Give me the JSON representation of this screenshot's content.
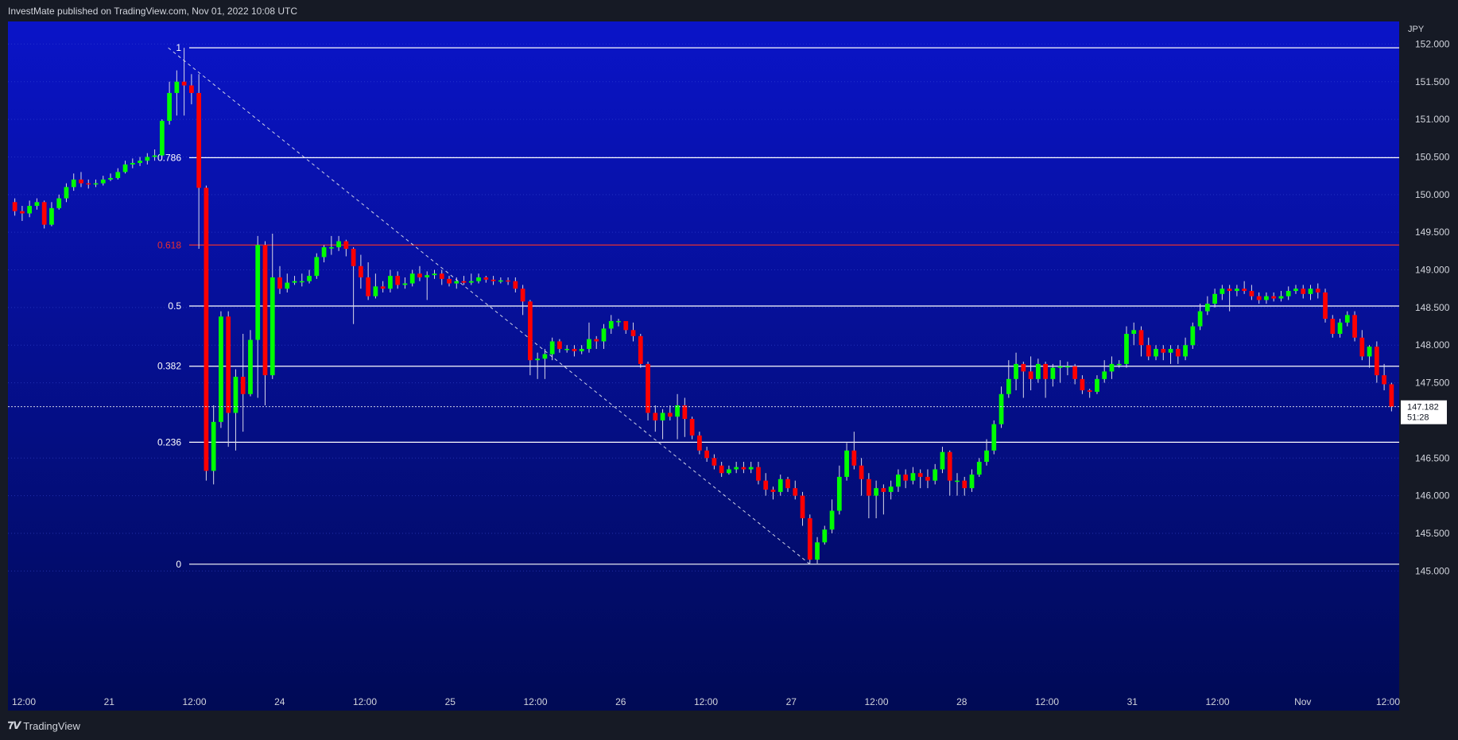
{
  "header": {
    "attribution": "InvestMate published on TradingView.com, Nov 01, 2022 10:08 UTC"
  },
  "footer": {
    "brand": "TradingView"
  },
  "colors": {
    "bg_top": "#0a14c8",
    "bg_bottom": "#000a55",
    "up": "#00ff00",
    "down": "#ff0000",
    "wick": "#d8d8e8",
    "level": "#ffffff",
    "level_618": "#e83030"
  },
  "chart_data": {
    "type": "candlestick",
    "symbol_currency": "JPY",
    "last_price_label": "147.182",
    "countdown_label": "51:28",
    "ylim": [
      144.75,
      152.3
    ],
    "y_ticks": [
      "152.000",
      "151.500",
      "151.000",
      "150.500",
      "150.000",
      "149.500",
      "149.000",
      "148.500",
      "148.000",
      "147.500",
      "146.500",
      "146.000",
      "145.500",
      "145.000"
    ],
    "x_ticks": [
      "12:00",
      "21",
      "12:00",
      "24",
      "12:00",
      "25",
      "12:00",
      "26",
      "12:00",
      "27",
      "12:00",
      "28",
      "12:00",
      "31",
      "12:00",
      "Nov",
      "12:00"
    ],
    "fib_levels": [
      {
        "label": "1",
        "price": 151.95
      },
      {
        "label": "0.786",
        "price": 150.49
      },
      {
        "label": "0.618",
        "price": 149.33
      },
      {
        "label": "0.5",
        "price": 148.52
      },
      {
        "label": "0.382",
        "price": 147.72
      },
      {
        "label": "0.236",
        "price": 146.71
      },
      {
        "label": "0",
        "price": 145.09
      }
    ],
    "candles": [
      [
        149.9,
        149.78,
        149.95,
        149.72
      ],
      [
        149.78,
        149.75,
        149.85,
        149.65
      ],
      [
        149.75,
        149.85,
        149.92,
        149.7
      ],
      [
        149.85,
        149.9,
        149.95,
        149.8
      ],
      [
        149.9,
        149.6,
        149.92,
        149.55
      ],
      [
        149.6,
        149.82,
        149.9,
        149.58
      ],
      [
        149.82,
        149.95,
        150.0,
        149.8
      ],
      [
        149.95,
        150.1,
        150.15,
        149.9
      ],
      [
        150.1,
        150.2,
        150.28,
        150.05
      ],
      [
        150.2,
        150.15,
        150.3,
        150.1
      ],
      [
        150.15,
        150.14,
        150.2,
        150.08
      ],
      [
        150.14,
        150.15,
        150.2,
        150.1
      ],
      [
        150.15,
        150.2,
        150.25,
        150.12
      ],
      [
        150.2,
        150.22,
        150.28,
        150.18
      ],
      [
        150.22,
        150.3,
        150.35,
        150.2
      ],
      [
        150.3,
        150.4,
        150.45,
        150.28
      ],
      [
        150.4,
        150.42,
        150.48,
        150.35
      ],
      [
        150.42,
        150.45,
        150.5,
        150.38
      ],
      [
        150.45,
        150.5,
        150.55,
        150.4
      ],
      [
        150.5,
        150.52,
        150.6,
        150.45
      ],
      [
        150.52,
        150.98,
        151.0,
        150.5
      ],
      [
        150.98,
        151.35,
        151.5,
        150.93
      ],
      [
        151.35,
        151.5,
        151.65,
        151.05
      ],
      [
        151.5,
        151.45,
        151.95,
        151.05
      ],
      [
        151.45,
        151.35,
        151.6,
        151.2
      ],
      [
        151.35,
        150.09,
        151.6,
        149.28
      ],
      [
        150.09,
        146.33,
        150.12,
        146.2
      ],
      [
        146.33,
        146.98,
        147.2,
        146.15
      ],
      [
        146.98,
        148.38,
        148.45,
        146.9
      ],
      [
        148.38,
        147.1,
        148.45,
        146.65
      ],
      [
        147.1,
        147.58,
        147.68,
        146.6
      ],
      [
        147.58,
        147.35,
        148.15,
        146.85
      ],
      [
        147.35,
        148.07,
        148.2,
        147.32
      ],
      [
        148.07,
        149.33,
        149.45,
        147.3
      ],
      [
        149.33,
        147.6,
        149.38,
        147.2
      ],
      [
        147.6,
        148.9,
        149.48,
        147.55
      ],
      [
        148.9,
        148.75,
        149.05,
        148.68
      ],
      [
        148.75,
        148.83,
        148.95,
        148.7
      ],
      [
        148.83,
        148.85,
        148.92,
        148.8
      ],
      [
        148.85,
        148.85,
        148.95,
        148.78
      ],
      [
        148.85,
        148.92,
        149.0,
        148.82
      ],
      [
        148.92,
        149.17,
        149.22,
        148.88
      ],
      [
        149.17,
        149.3,
        149.33,
        149.1
      ],
      [
        149.3,
        149.3,
        149.45,
        149.2
      ],
      [
        149.3,
        149.38,
        149.45,
        149.25
      ],
      [
        149.38,
        149.28,
        149.4,
        149.18
      ],
      [
        149.28,
        149.05,
        149.3,
        148.28
      ],
      [
        149.05,
        148.9,
        149.2,
        148.75
      ],
      [
        148.9,
        148.65,
        149.1,
        148.6
      ],
      [
        148.65,
        148.78,
        148.95,
        148.62
      ],
      [
        148.78,
        148.75,
        148.85,
        148.7
      ],
      [
        148.75,
        148.92,
        149.0,
        148.7
      ],
      [
        148.92,
        148.8,
        148.98,
        148.75
      ],
      [
        148.8,
        148.82,
        148.9,
        148.75
      ],
      [
        148.82,
        148.95,
        149.0,
        148.78
      ],
      [
        148.95,
        148.9,
        149.05,
        148.85
      ],
      [
        148.9,
        148.93,
        148.98,
        148.6
      ],
      [
        148.93,
        148.95,
        149.0,
        148.88
      ],
      [
        148.95,
        148.88,
        149.0,
        148.8
      ],
      [
        148.88,
        148.82,
        148.92,
        148.78
      ],
      [
        148.82,
        148.85,
        148.9,
        148.75
      ],
      [
        148.85,
        148.83,
        148.92,
        148.8
      ],
      [
        148.83,
        148.85,
        148.95,
        148.8
      ],
      [
        148.85,
        148.9,
        148.95,
        148.82
      ],
      [
        148.9,
        148.87,
        148.92,
        148.83
      ],
      [
        148.87,
        148.85,
        148.92,
        148.8
      ],
      [
        148.85,
        148.86,
        148.9,
        148.82
      ],
      [
        148.86,
        148.85,
        148.9,
        148.8
      ],
      [
        148.85,
        148.75,
        148.9,
        148.7
      ],
      [
        148.75,
        148.58,
        148.8,
        148.4
      ],
      [
        148.58,
        147.8,
        148.6,
        147.6
      ],
      [
        147.8,
        147.82,
        147.9,
        147.55
      ],
      [
        147.82,
        147.88,
        147.95,
        147.55
      ],
      [
        147.88,
        148.05,
        148.1,
        147.8
      ],
      [
        148.05,
        147.95,
        148.08,
        147.9
      ],
      [
        147.95,
        147.95,
        148.0,
        147.9
      ],
      [
        147.95,
        147.92,
        148.0,
        147.85
      ],
      [
        147.92,
        147.95,
        148.0,
        147.88
      ],
      [
        147.95,
        148.08,
        148.3,
        147.9
      ],
      [
        148.08,
        148.05,
        148.12,
        147.95
      ],
      [
        148.05,
        148.22,
        148.28,
        147.95
      ],
      [
        148.22,
        148.32,
        148.4,
        148.15
      ],
      [
        148.32,
        148.32,
        148.35,
        148.25
      ],
      [
        148.32,
        148.2,
        148.25,
        148.15
      ],
      [
        148.2,
        148.12,
        148.3,
        148.05
      ],
      [
        148.12,
        147.75,
        148.15,
        147.7
      ],
      [
        147.75,
        147.1,
        147.78,
        147.0
      ],
      [
        147.1,
        147.0,
        147.2,
        146.85
      ],
      [
        147.0,
        147.1,
        147.15,
        146.75
      ],
      [
        147.1,
        147.05,
        147.2,
        147.0
      ],
      [
        147.05,
        147.2,
        147.35,
        146.75
      ],
      [
        147.2,
        147.02,
        147.3,
        146.78
      ],
      [
        147.02,
        146.8,
        147.05,
        146.75
      ],
      [
        146.8,
        146.6,
        146.85,
        146.55
      ],
      [
        146.6,
        146.5,
        146.65,
        146.45
      ],
      [
        146.5,
        146.4,
        146.55,
        146.35
      ],
      [
        146.4,
        146.3,
        146.45,
        146.25
      ],
      [
        146.3,
        146.35,
        146.4,
        146.28
      ],
      [
        146.35,
        146.38,
        146.45,
        146.3
      ],
      [
        146.38,
        146.35,
        146.45,
        146.3
      ],
      [
        146.35,
        146.38,
        146.45,
        146.3
      ],
      [
        146.38,
        146.2,
        146.45,
        146.15
      ],
      [
        146.2,
        146.08,
        146.3,
        146.0
      ],
      [
        146.08,
        146.05,
        146.12,
        145.95
      ],
      [
        146.05,
        146.22,
        146.28,
        146.0
      ],
      [
        146.22,
        146.1,
        146.25,
        146.05
      ],
      [
        146.1,
        146.0,
        146.2,
        145.95
      ],
      [
        146.0,
        145.7,
        146.05,
        145.6
      ],
      [
        145.7,
        145.15,
        145.75,
        145.1
      ],
      [
        145.15,
        145.38,
        145.45,
        145.1
      ],
      [
        145.38,
        145.55,
        145.6,
        145.35
      ],
      [
        145.55,
        145.8,
        145.95,
        145.5
      ],
      [
        145.8,
        146.25,
        146.4,
        145.75
      ],
      [
        146.25,
        146.6,
        146.7,
        146.2
      ],
      [
        146.6,
        146.4,
        146.85,
        146.35
      ],
      [
        146.4,
        146.22,
        146.5,
        146.0
      ],
      [
        146.22,
        146.0,
        146.3,
        145.7
      ],
      [
        146.0,
        146.1,
        146.2,
        145.7
      ],
      [
        146.1,
        146.05,
        146.15,
        145.75
      ],
      [
        146.05,
        146.12,
        146.2,
        145.95
      ],
      [
        146.12,
        146.28,
        146.35,
        146.05
      ],
      [
        146.28,
        146.2,
        146.35,
        146.1
      ],
      [
        146.2,
        146.3,
        146.38,
        146.15
      ],
      [
        146.3,
        146.25,
        146.35,
        146.1
      ],
      [
        146.25,
        146.2,
        146.35,
        146.1
      ],
      [
        146.2,
        146.35,
        146.42,
        146.15
      ],
      [
        146.35,
        146.58,
        146.65,
        146.3
      ],
      [
        146.58,
        146.2,
        146.6,
        146.0
      ],
      [
        146.2,
        146.2,
        146.3,
        146.0
      ],
      [
        146.2,
        146.1,
        146.25,
        146.0
      ],
      [
        146.1,
        146.28,
        146.35,
        146.05
      ],
      [
        146.28,
        146.45,
        146.5,
        146.25
      ],
      [
        146.45,
        146.6,
        146.75,
        146.4
      ],
      [
        146.6,
        146.95,
        147.0,
        146.55
      ],
      [
        146.95,
        147.35,
        147.45,
        146.9
      ],
      [
        147.35,
        147.55,
        147.8,
        147.3
      ],
      [
        147.55,
        147.75,
        147.9,
        147.4
      ],
      [
        147.75,
        147.65,
        147.78,
        147.3
      ],
      [
        147.65,
        147.55,
        147.85,
        147.4
      ],
      [
        147.55,
        147.75,
        147.82,
        147.5
      ],
      [
        147.75,
        147.55,
        147.78,
        147.3
      ],
      [
        147.55,
        147.7,
        147.75,
        147.45
      ],
      [
        147.7,
        147.72,
        147.8,
        147.5
      ],
      [
        147.72,
        147.72,
        147.78,
        147.6
      ],
      [
        147.72,
        147.55,
        147.75,
        147.48
      ],
      [
        147.55,
        147.4,
        147.6,
        147.35
      ],
      [
        147.4,
        147.38,
        147.42,
        147.3
      ],
      [
        147.38,
        147.55,
        147.6,
        147.35
      ],
      [
        147.55,
        147.65,
        147.8,
        147.5
      ],
      [
        147.65,
        147.75,
        147.85,
        147.55
      ],
      [
        147.75,
        147.75,
        147.8,
        147.7
      ],
      [
        147.75,
        148.15,
        148.25,
        147.7
      ],
      [
        148.15,
        148.2,
        148.3,
        148.0
      ],
      [
        148.2,
        148.0,
        148.25,
        147.85
      ],
      [
        148.0,
        147.85,
        148.1,
        147.8
      ],
      [
        147.85,
        147.95,
        148.0,
        147.8
      ],
      [
        147.95,
        147.9,
        148.0,
        147.8
      ],
      [
        147.9,
        147.95,
        148.0,
        147.75
      ],
      [
        147.95,
        147.85,
        148.0,
        147.75
      ],
      [
        147.85,
        148.0,
        148.1,
        147.8
      ],
      [
        148.0,
        148.25,
        148.3,
        147.95
      ],
      [
        148.25,
        148.45,
        148.55,
        148.2
      ],
      [
        148.45,
        148.55,
        148.65,
        148.4
      ],
      [
        148.55,
        148.68,
        148.75,
        148.5
      ],
      [
        148.68,
        148.75,
        148.8,
        148.6
      ],
      [
        148.75,
        148.72,
        148.8,
        148.45
      ],
      [
        148.72,
        148.75,
        148.8,
        148.65
      ],
      [
        148.75,
        148.72,
        148.85,
        148.68
      ],
      [
        148.72,
        148.65,
        148.8,
        148.6
      ],
      [
        148.65,
        148.6,
        148.7,
        148.55
      ],
      [
        148.6,
        148.65,
        148.7,
        148.55
      ],
      [
        148.65,
        148.62,
        148.7,
        148.58
      ],
      [
        148.62,
        148.65,
        148.72,
        148.58
      ],
      [
        148.65,
        148.72,
        148.78,
        148.6
      ],
      [
        148.72,
        148.75,
        148.8,
        148.68
      ],
      [
        148.75,
        148.68,
        148.8,
        148.62
      ],
      [
        148.68,
        148.75,
        148.8,
        148.6
      ],
      [
        148.75,
        148.7,
        148.82,
        148.62
      ],
      [
        148.7,
        148.35,
        148.75,
        148.3
      ],
      [
        148.35,
        148.15,
        148.4,
        148.1
      ],
      [
        148.15,
        148.3,
        148.35,
        148.1
      ],
      [
        148.3,
        148.4,
        148.45,
        148.25
      ],
      [
        148.4,
        148.1,
        148.45,
        148.05
      ],
      [
        148.1,
        147.85,
        148.2,
        147.8
      ],
      [
        147.85,
        147.98,
        148.0,
        147.7
      ],
      [
        147.98,
        147.6,
        148.05,
        147.5
      ],
      [
        147.6,
        147.48,
        147.75,
        147.4
      ],
      [
        147.48,
        147.18,
        147.5,
        147.12
      ]
    ]
  }
}
